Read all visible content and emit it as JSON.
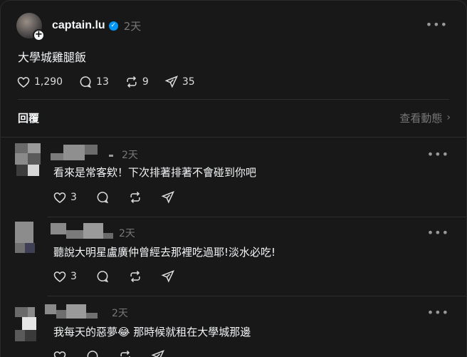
{
  "post": {
    "username": "captain.lu",
    "time": "2天",
    "text": "大學城雞腿飯",
    "likes": "1,290",
    "comments": "13",
    "reposts": "9",
    "shares": "35"
  },
  "replies_section": {
    "label": "回覆",
    "activity_link": "查看動態"
  },
  "replies": [
    {
      "time": "2天",
      "text": "看來是常客欸！下次排著排著不會碰到你吧",
      "likes": "3"
    },
    {
      "time": "2天",
      "text": "聽說大明星盧廣仲曾經去那裡吃過耶!淡水必吃!",
      "likes": "3"
    },
    {
      "time": "2天",
      "text": "我每天的惡夢😂 那時候就租在大學城那邊",
      "likes": ""
    }
  ],
  "icons": {
    "more": "more-icon",
    "heart": "heart-icon",
    "comment": "comment-icon",
    "repost": "repost-icon",
    "share": "share-icon",
    "verified": "verified-badge-icon",
    "follow": "plus-icon"
  },
  "colors": {
    "background": "#181818",
    "text": "#f3f5f7",
    "muted": "#777777",
    "verified": "#0095f6"
  }
}
